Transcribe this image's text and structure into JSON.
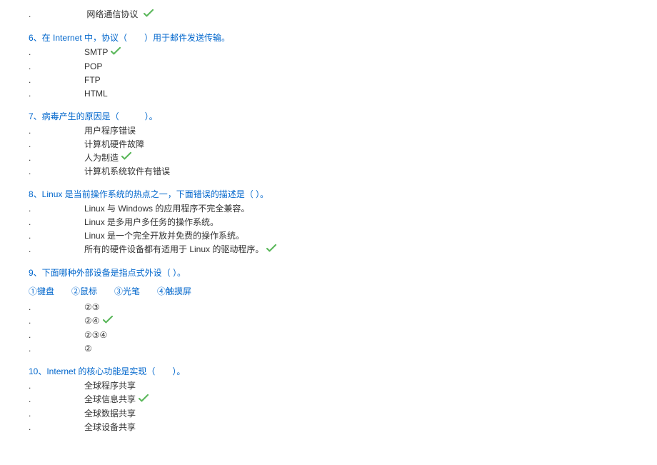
{
  "q5_trailing_option": "网络通信协议",
  "q6": {
    "title": "6、在 Internet 中，协议（　　）用于邮件发送传输。",
    "options": [
      "SMTP",
      "POP",
      "FTP",
      "HTML"
    ],
    "correct": 0
  },
  "q7": {
    "title": "7、病毒产生的原因是（　　　）。",
    "options": [
      "用户程序错误",
      "计算机硬件故障",
      "人为制造",
      "计算机系统软件有错误"
    ],
    "correct": 2
  },
  "q8": {
    "title": "8、Linux 是当前操作系统的热点之一，下面错误的描述是（  ）。",
    "options": [
      "Linux 与 Windows 的应用程序不完全兼容。",
      "Linux 是多用户多任务的操作系统。",
      "Linux 是一个完全开放并免费的操作系统。",
      "所有的硬件设备都有适用于 Linux 的驱动程序。"
    ],
    "correct": 3
  },
  "q9": {
    "title": "9、下面哪种外部设备是指点式外设（  ）。",
    "sub": "①键盘　　②鼠标　　③光笔　　④触摸屏",
    "options": [
      "②③",
      "②④",
      "②③④",
      "②"
    ],
    "correct": 1
  },
  "q10": {
    "title": "10、Internet 的核心功能是实现（　　）。",
    "options": [
      "全球程序共享",
      "全球信息共享",
      "全球数据共享",
      "全球设备共享"
    ],
    "correct": 1
  }
}
